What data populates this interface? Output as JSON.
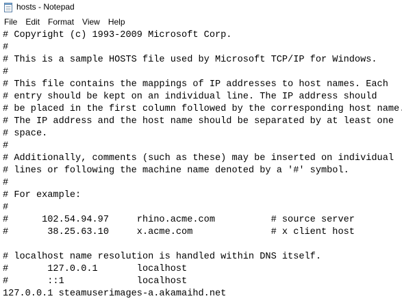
{
  "window": {
    "title": "hosts - Notepad",
    "icon": "notepad-icon"
  },
  "menu": {
    "file": "File",
    "edit": "Edit",
    "format": "Format",
    "view": "View",
    "help": "Help"
  },
  "editor": {
    "lines": [
      "# Copyright (c) 1993-2009 Microsoft Corp.",
      "#",
      "# This is a sample HOSTS file used by Microsoft TCP/IP for Windows.",
      "#",
      "# This file contains the mappings of IP addresses to host names. Each",
      "# entry should be kept on an individual line. The IP address should",
      "# be placed in the first column followed by the corresponding host name.",
      "# The IP address and the host name should be separated by at least one",
      "# space.",
      "#",
      "# Additionally, comments (such as these) may be inserted on individual",
      "# lines or following the machine name denoted by a '#' symbol.",
      "#",
      "# For example:",
      "#",
      "#      102.54.94.97     rhino.acme.com          # source server",
      "#       38.25.63.10     x.acme.com              # x client host",
      "",
      "# localhost name resolution is handled within DNS itself.",
      "#\t127.0.0.1       localhost",
      "#\t::1             localhost",
      "127.0.0.1 steamuserimages-a.akamaihd.net"
    ]
  }
}
